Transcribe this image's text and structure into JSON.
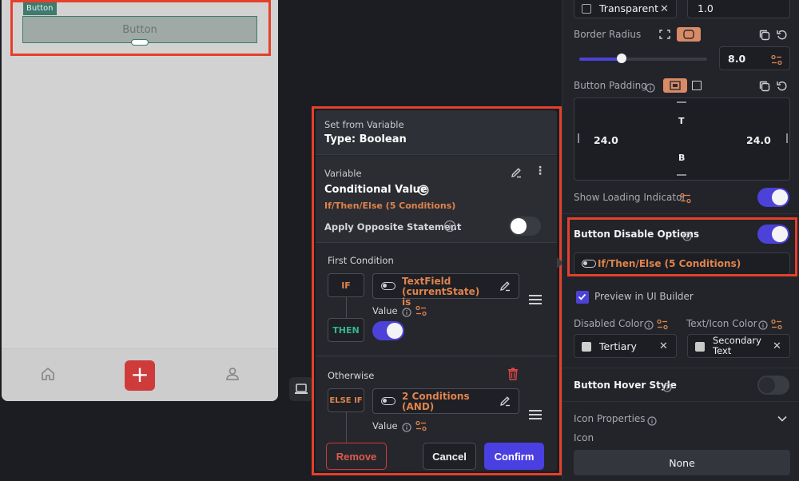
{
  "canvas": {
    "button_tag": "Button",
    "button_label": "Button",
    "fab_symbol": "+"
  },
  "icons": {
    "home": "home-icon",
    "plus": "plus-icon",
    "person": "person-icon",
    "device": "laptop-icon"
  },
  "popover": {
    "header_sub": "Set from Variable",
    "header_title": "Type: Boolean",
    "variable": {
      "label": "Variable",
      "name": "Conditional Value",
      "summary": "If/Then/Else (5 Conditions)",
      "opposite_label": "Apply Opposite Statement",
      "opposite_on": false
    },
    "first_condition": {
      "title": "First Condition",
      "if_tag": "IF",
      "if_text": "TextField (currentState) is",
      "value_label": "Value",
      "then_tag": "THEN",
      "then_on": true
    },
    "otherwise": {
      "title": "Otherwise",
      "else_tag": "ELSE IF",
      "else_text": "2 Conditions (AND)",
      "value_label": "Value"
    },
    "actions": {
      "remove": "Remove",
      "cancel": "Cancel",
      "confirm": "Confirm"
    }
  },
  "panel": {
    "transparent_label": "Transparent",
    "opacity_value": "1.0",
    "border_radius_label": "Border Radius",
    "border_radius_value": "8.0",
    "border_radius_fraction": 0.33,
    "button_padding_label": "Button Padding",
    "padding_top": "T",
    "padding_bottom": "B",
    "padding_left": "24.0",
    "padding_right": "24.0",
    "show_loading_label": "Show Loading Indicator",
    "show_loading_on": true,
    "disable_label": "Button Disable Options",
    "disable_on": true,
    "disable_value": "If/Then/Else (5 Conditions)",
    "preview_label": "Preview in UI Builder",
    "preview_checked": true,
    "disabled_color_label": "Disabled Color",
    "disabled_color_value": "Tertiary",
    "text_icon_color_label": "Text/Icon Color",
    "text_icon_color_value": "Secondary Text",
    "hover_label": "Button Hover Style",
    "hover_on": false,
    "icon_props_label": "Icon Properties",
    "icon_label": "Icon",
    "icon_value": "None"
  }
}
